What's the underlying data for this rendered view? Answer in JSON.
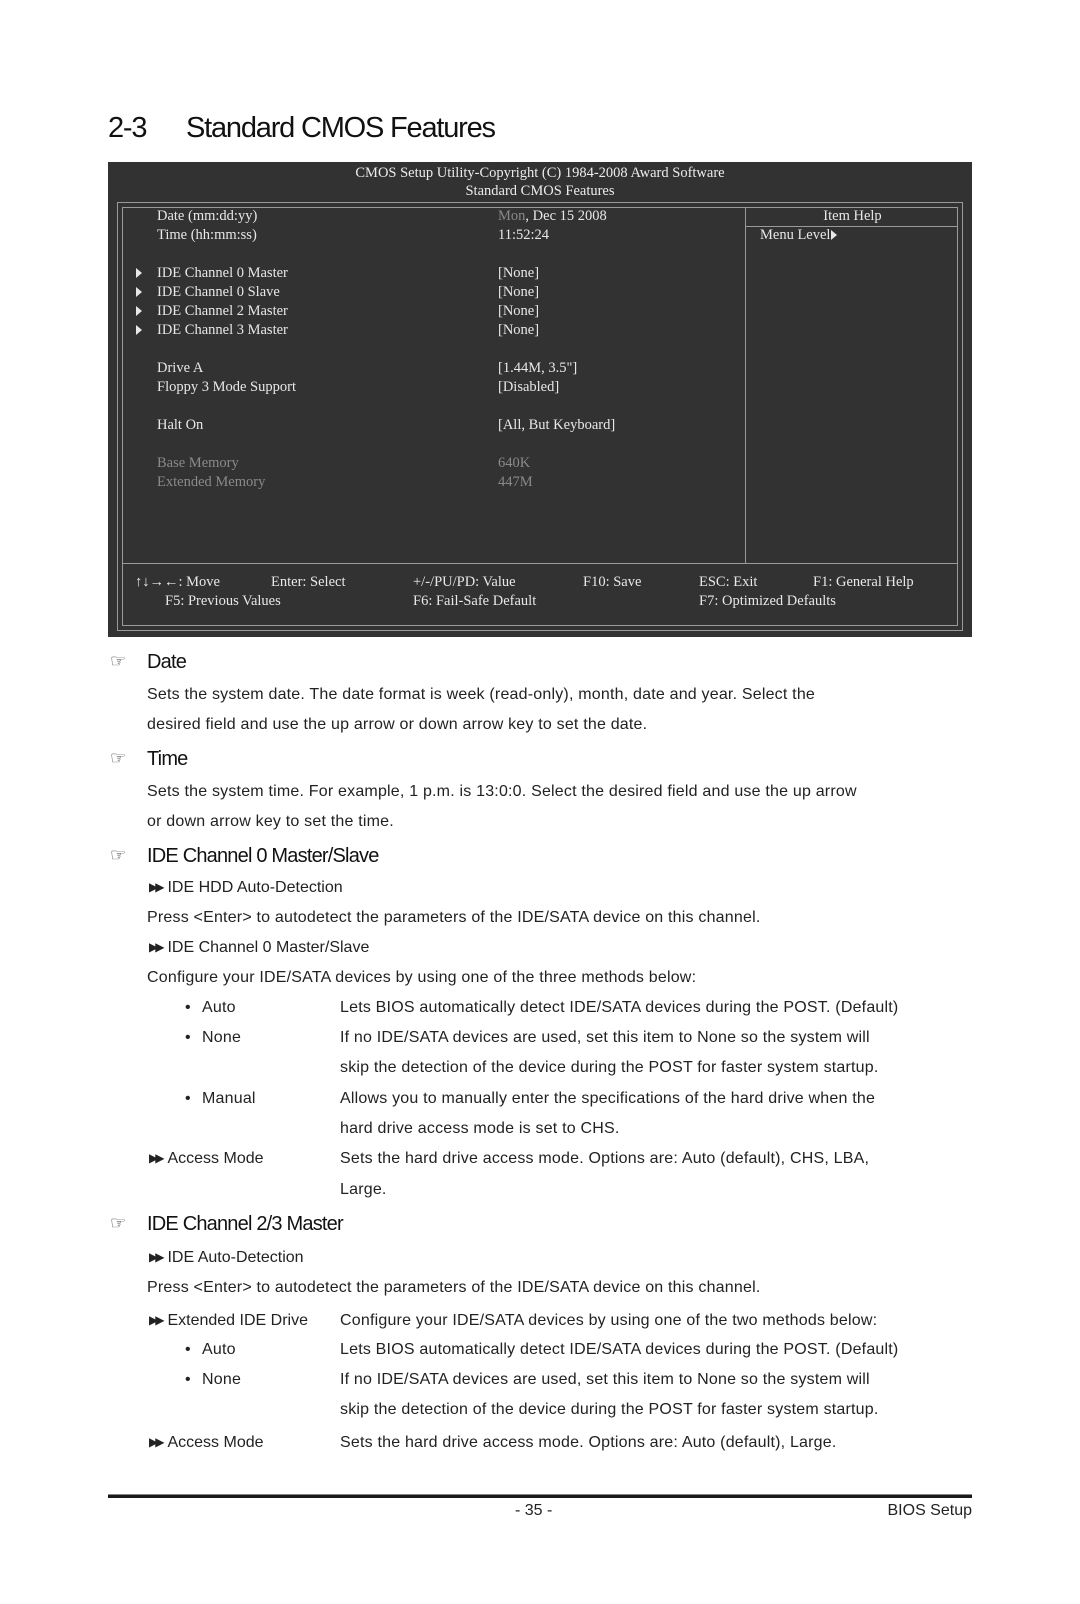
{
  "page": {
    "section_number": "2-3",
    "section_title": "Standard CMOS Features",
    "page_number": "- 35 -",
    "footer_label": "BIOS Setup"
  },
  "bios": {
    "header_line1": "CMOS Setup Utility-Copyright (C) 1984-2008 Award Software",
    "header_line2": "Standard CMOS Features",
    "items": [
      {
        "label": "Date (mm:dd:yy)",
        "value_prefix": "Mon",
        "value": ", Dec  15  2008",
        "submenu": false,
        "dim": false
      },
      {
        "label": "Time (hh:mm:ss)",
        "value_prefix": "",
        "value": "11:52:24",
        "submenu": false,
        "dim": false
      },
      {
        "label": "IDE Channel 0 Master",
        "value_prefix": "",
        "value": "[None]",
        "submenu": true,
        "dim": false
      },
      {
        "label": "IDE Channel 0 Slave",
        "value_prefix": "",
        "value": "[None]",
        "submenu": true,
        "dim": false
      },
      {
        "label": "IDE Channel 2 Master",
        "value_prefix": "",
        "value": "[None]",
        "submenu": true,
        "dim": false
      },
      {
        "label": "IDE Channel 3 Master",
        "value_prefix": "",
        "value": "[None]",
        "submenu": true,
        "dim": false
      },
      {
        "label": "Drive A",
        "value_prefix": "",
        "value": "[1.44M, 3.5\"]",
        "submenu": false,
        "dim": false
      },
      {
        "label": "Floppy 3 Mode Support",
        "value_prefix": "",
        "value": "[Disabled]",
        "submenu": false,
        "dim": false
      },
      {
        "label": "Halt On",
        "value_prefix": "",
        "value": "[All, But Keyboard]",
        "submenu": false,
        "dim": false
      },
      {
        "label": "Base Memory",
        "value_prefix": "",
        "value": "640K",
        "submenu": false,
        "dim": true
      },
      {
        "label": "Extended Memory",
        "value_prefix": "",
        "value": "447M",
        "submenu": false,
        "dim": true
      }
    ],
    "help_title": "Item Help",
    "help_menu_level": "Menu Level",
    "keys_row1": [
      "↑↓→←: Move",
      "Enter: Select",
      "+/-/PU/PD: Value",
      "F10: Save",
      "ESC: Exit",
      "F1: General Help"
    ],
    "keys_row2": [
      "F5: Previous Values",
      "F6: Fail-Safe Default",
      "F7: Optimized Defaults"
    ]
  },
  "sections": {
    "date": {
      "title": "Date",
      "line1": "Sets the system date. The date format is week (read-only), month, date and  year.  Select  the",
      "line2": "desired field and use the up arrow or down arrow key to set the date."
    },
    "time": {
      "title": "Time",
      "line1": "Sets the system time. For example, 1 p.m. is 13:0:0. Select the desired field and use the up arrow",
      "line2": "or down arrow key to set the time."
    },
    "ide01": {
      "title": "IDE Channel 0 Master/Slave",
      "sub1": "IDE HDD Auto-Detection",
      "sub1_desc": "Press <Enter> to autodetect the parameters of the IDE/SATA device on this channel.",
      "sub2": "IDE Channel 0 Master/Slave",
      "sub2_desc": "Configure your IDE/SATA devices by using one of the three methods below:",
      "options": [
        {
          "name": "Auto",
          "lines": [
            "Lets BIOS automatically detect IDE/SATA devices during the POST. (Default)"
          ]
        },
        {
          "name": "None",
          "lines": [
            "If no IDE/SATA devices are used, set this item to None so the system will",
            "skip the detection of the device during the POST for faster system startup."
          ]
        },
        {
          "name": "Manual",
          "lines": [
            "Allows you to manually enter the specifications of the hard drive when the",
            "hard drive access mode is set to CHS."
          ]
        }
      ],
      "access_label": "Access Mode",
      "access_lines": [
        "Sets the hard drive access mode. Options are: Auto (default), CHS, LBA,",
        "Large."
      ]
    },
    "ide23": {
      "title": "IDE Channel 2/3 Master",
      "sub1": "IDE Auto-Detection",
      "sub1_desc": "Press <Enter> to autodetect the parameters of the IDE/SATA device on this channel.",
      "sub2": "Extended IDE Drive",
      "sub2_desc": "Configure your IDE/SATA devices by using one of the two methods below:",
      "options": [
        {
          "name": "Auto",
          "lines": [
            "Lets BIOS automatically detect IDE/SATA devices during the POST. (Default)"
          ]
        },
        {
          "name": "None",
          "lines": [
            "If no IDE/SATA devices are used, set this item to None so the system will",
            "skip the detection of the device during the POST for faster system startup."
          ]
        }
      ],
      "access_label": "Access Mode",
      "access_lines": [
        "Sets the hard drive access mode. Options are: Auto (default), Large."
      ]
    }
  },
  "icons": {
    "pointing_hand": "☞",
    "double_arrow": "▶▶",
    "submenu_arrow": "triangle-right"
  }
}
